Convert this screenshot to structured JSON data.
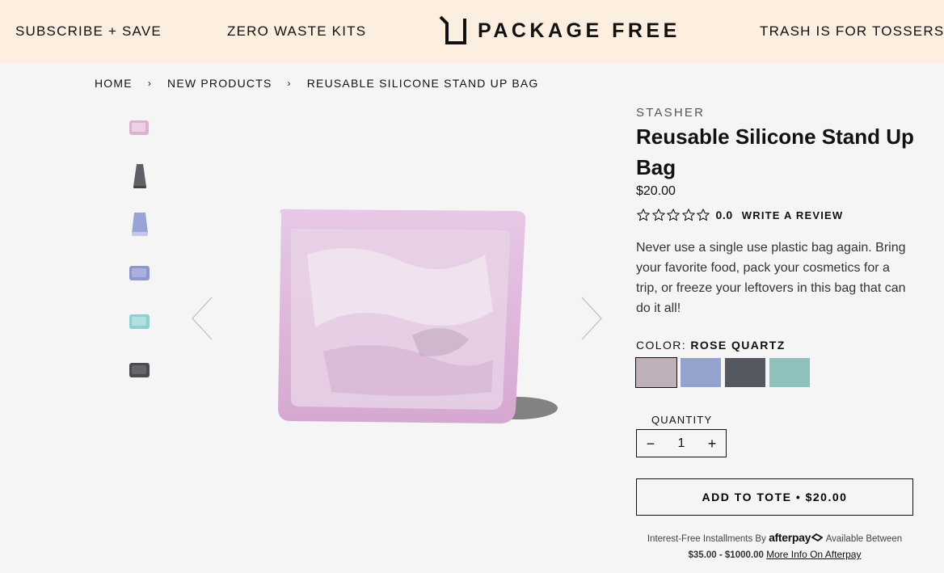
{
  "header": {
    "nav_left": [
      "SUBSCRIBE + SAVE",
      "ZERO WASTE KITS"
    ],
    "logo_text": "PACKAGE FREE",
    "nav_right": "TRASH IS FOR TOSSERS",
    "background": "#fdefe0"
  },
  "breadcrumb": {
    "items": [
      "HOME",
      "NEW PRODUCTS",
      "REUSABLE SILICONE STAND UP BAG"
    ],
    "separator": "›"
  },
  "gallery": {
    "thumbnails": [
      {
        "name": "rose-quartz-sandwich-thumb",
        "color": "#d8aec4"
      },
      {
        "name": "gray-standup-thumb",
        "color": "#5f6066"
      },
      {
        "name": "lavender-standup-thumb",
        "color": "#9aa3d6"
      },
      {
        "name": "lavender-sandwich-thumb",
        "color": "#8e98cc"
      },
      {
        "name": "aqua-sandwich-thumb",
        "color": "#8fcfcf"
      },
      {
        "name": "dark-gray-sandwich-thumb",
        "color": "#4a4b50"
      }
    ],
    "main_color": "#dcb3d6",
    "prev_icon": "chevron-left-icon",
    "next_icon": "chevron-right-icon"
  },
  "product": {
    "brand": "STASHER",
    "title": "Reusable Silicone Stand Up Bag",
    "price": "$20.00",
    "rating_value": "0.0",
    "star_count": 5,
    "rating_stars_filled": 0,
    "review_link": "WRITE A REVIEW",
    "description": "Never use a single use plastic bag again. Bring your favorite food, pack your cosmetics for a trip, or freeze your leftovers in this bag that can do it all!",
    "color_label": "COLOR:",
    "color_selected": "ROSE QUARTZ",
    "swatches": [
      {
        "name": "Rose Quartz",
        "color": "#bfb0b9",
        "selected": true
      },
      {
        "name": "Lavender",
        "color": "#95a2cd",
        "selected": false
      },
      {
        "name": "Slate Gray",
        "color": "#545861",
        "selected": false
      },
      {
        "name": "Aqua",
        "color": "#8ec1bb",
        "selected": false
      }
    ],
    "quantity_label": "QUANTITY",
    "quantity_value": "1",
    "qty_minus": "−",
    "qty_plus": "+",
    "add_button": "ADD TO TOTE • $20.00"
  },
  "afterpay": {
    "prefix": "Interest-Free Installments By",
    "logo": "afterpay",
    "middle": "Available Between",
    "range": "$35.00 - $1000.00",
    "link": "More Info On Afterpay"
  }
}
